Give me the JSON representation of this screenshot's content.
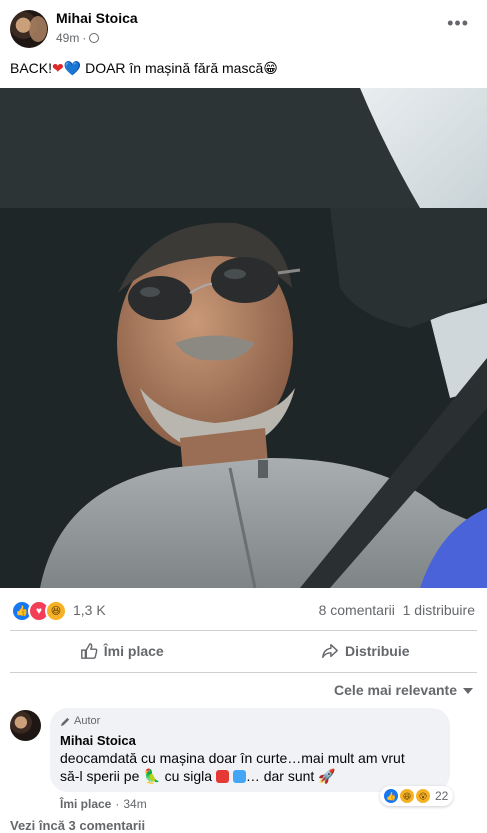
{
  "post": {
    "author": "Mihai Stoica",
    "time": "49m",
    "meta_sep": "·",
    "text": "BACK!",
    "text_emoji_1": "❤",
    "text_emoji_2": "💙",
    "text_rest": " DOAR în mașină fără mască",
    "text_emoji_3": "😁"
  },
  "reactions": {
    "count": "1,3 K",
    "icons": [
      "like-icon",
      "love-icon",
      "haha-icon"
    ],
    "comments": "8 comentarii",
    "shares": "1 distribuire"
  },
  "actions": {
    "like_label": "Îmi place",
    "share_label": "Distribuie"
  },
  "comments": {
    "sort_label": "Cele mai relevante",
    "items": [
      {
        "badge": "Autor",
        "author": "Mihai Stoica",
        "line1": "deocamdată cu mașina doar în curte…mai mult am vrut",
        "line2_a": "să-l sperii pe ",
        "line2_b": " cu sigla ",
        "line2_c": "… dar sunt ",
        "reaction_count": "22",
        "like_label": "Îmi place",
        "time": "34m"
      }
    ],
    "more_label": "Vezi încă 3 comentarii"
  },
  "colors": {
    "accent": "#1877f2",
    "love": "#f33e58",
    "secondary_text": "#65676b"
  }
}
